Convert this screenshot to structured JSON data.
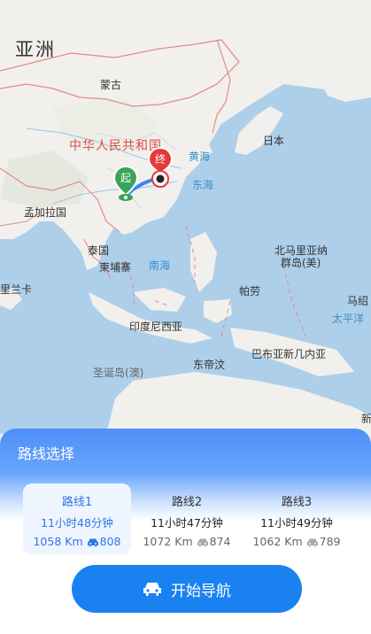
{
  "map": {
    "labels": {
      "asia": "亚洲",
      "mongolia": "蒙古",
      "china": "中华人民共和国",
      "yellow_sea": "黄海",
      "japan": "日本",
      "east_sea": "东海",
      "bangladesh": "孟加拉国",
      "thailand": "泰国",
      "cambodia": "柬埔寨",
      "south_sea": "南海",
      "sri_lanka": "里兰卡",
      "nmi_1": "北马里亚纳",
      "nmi_2": "群岛(美)",
      "palau": "帕劳",
      "pacific_1": "马绍",
      "pacific_2": "太平洋",
      "indonesia": "印度尼西亚",
      "timor": "东帝汶",
      "png": "巴布亚新几内亚",
      "christmas": "圣诞岛(澳)",
      "nz_edge": "新"
    },
    "start_marker": "起",
    "end_marker": "终"
  },
  "panel": {
    "title": "路线选择",
    "routes": [
      {
        "name": "路线1",
        "time": "11小时48分钟",
        "distance": "1058 Km",
        "toll": "808",
        "active": true
      },
      {
        "name": "路线2",
        "time": "11小时47分钟",
        "distance": "1072 Km",
        "toll": "874",
        "active": false
      },
      {
        "name": "路线3",
        "time": "11小时49分钟",
        "distance": "1062 Km",
        "toll": "789",
        "active": false
      }
    ],
    "start_button": "开始导航"
  },
  "colors": {
    "accent": "#1a82f0",
    "header_gradient": "#4f8ff7",
    "start_marker": "#3aa35a",
    "end_marker": "#e23b3b"
  }
}
